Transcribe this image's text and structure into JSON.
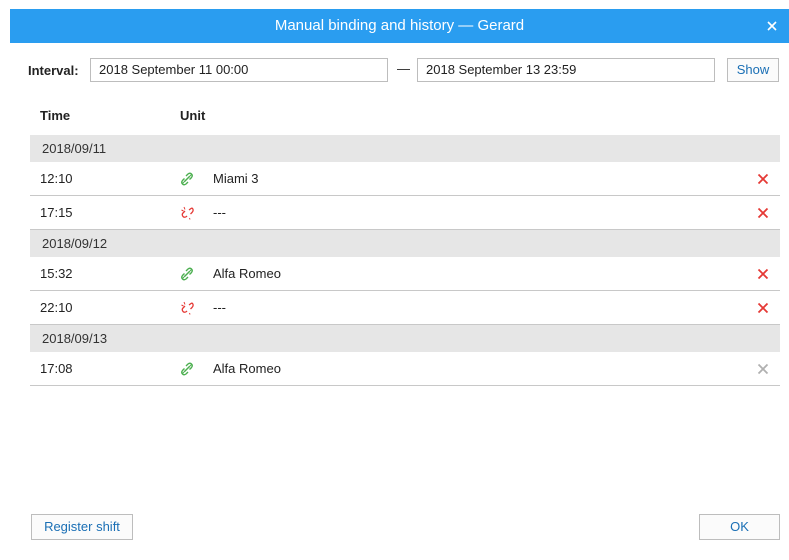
{
  "dialog": {
    "title": "Manual binding and history — Gerard"
  },
  "interval": {
    "label": "Interval:",
    "from": "2018 September 11 00:00",
    "separator": "—",
    "to": "2018 September 13 23:59",
    "show_label": "Show"
  },
  "columns": {
    "time": "Time",
    "unit": "Unit"
  },
  "groups": [
    {
      "date": "2018/09/11",
      "rows": [
        {
          "time": "12:10",
          "status": "bound",
          "unit": "Miami 3",
          "delete_enabled": true
        },
        {
          "time": "17:15",
          "status": "unbound",
          "unit": "---",
          "delete_enabled": true
        }
      ]
    },
    {
      "date": "2018/09/12",
      "rows": [
        {
          "time": "15:32",
          "status": "bound",
          "unit": "Alfa Romeo",
          "delete_enabled": true
        },
        {
          "time": "22:10",
          "status": "unbound",
          "unit": "---",
          "delete_enabled": true
        }
      ]
    },
    {
      "date": "2018/09/13",
      "rows": [
        {
          "time": "17:08",
          "status": "bound",
          "unit": "Alfa Romeo",
          "delete_enabled": false
        }
      ]
    }
  ],
  "footer": {
    "register_label": "Register shift",
    "ok_label": "OK"
  },
  "colors": {
    "titlebar": "#2a9df0",
    "bound_icon": "#4caf50",
    "unbound_icon": "#e53935",
    "delete_active": "#e53935",
    "delete_disabled": "#b0b0b0"
  }
}
